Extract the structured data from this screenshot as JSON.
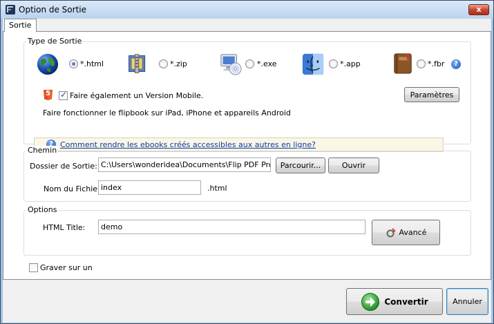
{
  "window": {
    "title": "Option de Sortie",
    "close_glyph": "x"
  },
  "tabs": [
    {
      "label": "Sortie"
    }
  ],
  "output_type": {
    "group_label": "Type de Sortie",
    "options": [
      {
        "label": "*.html",
        "icon": "globe-icon",
        "selected": true
      },
      {
        "label": "*.zip",
        "icon": "zip-archive-icon",
        "selected": false
      },
      {
        "label": "*.exe",
        "icon": "computer-cd-icon",
        "selected": false
      },
      {
        "label": "*.app",
        "icon": "mac-finder-icon",
        "selected": false
      },
      {
        "label": "*.fbr",
        "icon": "book-icon",
        "selected": false
      }
    ],
    "html5_badge": "5",
    "mobile_checkbox_label": "Faire également un Version Mobile.",
    "mobile_checked": true,
    "params_button": "Paramètres",
    "mobile_note": "Faire fonctionner le flipbook sur iPad, iPhone et appareils Android",
    "help_link": "Comment rendre les ebooks créés accessibles aux autres en ligne?",
    "help_glyph": "?"
  },
  "path": {
    "group_label": "Chemin",
    "folder_label": "Dossier de Sortie:",
    "folder_value": "C:\\Users\\wonderidea\\Documents\\Flip PDF Professional",
    "browse_button": "Parcourir...",
    "open_button": "Ouvrir",
    "filename_label": "Nom du Fichier:",
    "filename_value": "index",
    "extension": ".html"
  },
  "options": {
    "group_label": "Options",
    "html_title_label": "HTML Title:",
    "html_title_value": "demo",
    "advanced_button": "Avancé"
  },
  "burn_label": "Graver sur un",
  "burn_checked": false,
  "convert_button": "Convertir",
  "cancel_button": "Annuler",
  "colors": {
    "accent": "#1f4f9c",
    "link": "#0b3aa5",
    "convert_green": "#2e9e2e"
  }
}
